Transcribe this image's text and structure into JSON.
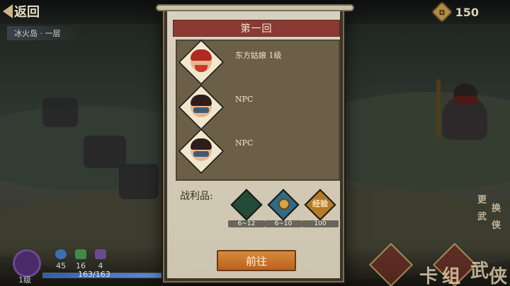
{
  "hud": {
    "back_label": "返回",
    "location": "冰火岛 · 一层",
    "currency_amount": "150",
    "player_level": "1级",
    "stats": [
      "45",
      "16",
      "4"
    ],
    "hp_text": "163/163",
    "hp_fraction": 1.0,
    "side_text": [
      "卡",
      "组",
      "武",
      "侠"
    ],
    "corner_text": [
      "更",
      "换",
      "武",
      "侠"
    ]
  },
  "dialog": {
    "title": "第一回",
    "enemies": [
      {
        "name": "东方姑娘 1级",
        "portrait": "red-haired-warrior"
      },
      {
        "name": "NPC",
        "portrait": "masked-woman"
      },
      {
        "name": "NPC",
        "portrait": "masked-woman"
      }
    ],
    "loot_label": "战利品:",
    "loot": [
      {
        "icon": "dark-gem-icon",
        "label": "",
        "range": "6~12",
        "color": "#244a3a"
      },
      {
        "icon": "coin-icon",
        "label": "",
        "range": "6~10",
        "color": "#2f6a86"
      },
      {
        "icon": "exp-icon",
        "label": "经验",
        "range": "100",
        "color": "#b47a26"
      }
    ],
    "go_label": "前往"
  },
  "colors": {
    "banner": "#8a3a33",
    "go_button": "#c8702a",
    "panel": "#6b5f48"
  }
}
